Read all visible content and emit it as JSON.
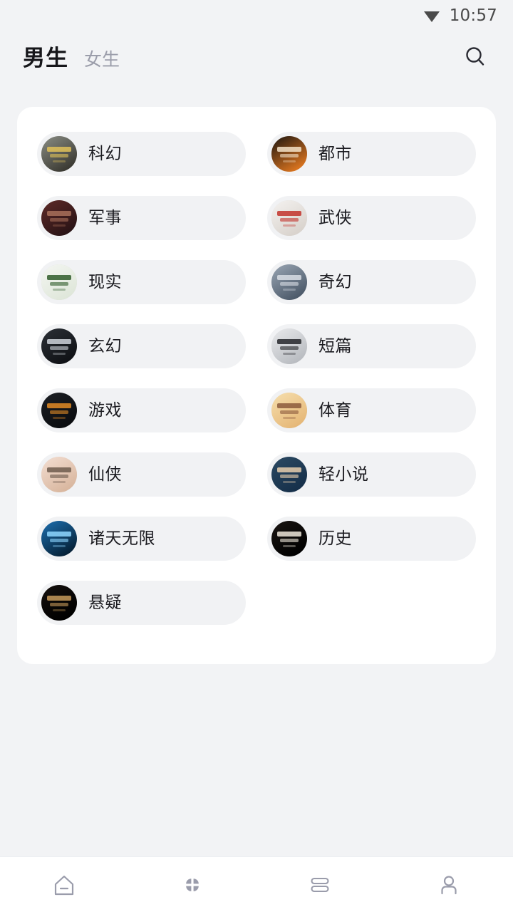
{
  "statusbar": {
    "time": "10:57",
    "wifi_icon": "wifi-icon"
  },
  "header": {
    "tabs": [
      {
        "label": "男生",
        "active": true
      },
      {
        "label": "女生",
        "active": false
      }
    ],
    "search_icon": "search-icon"
  },
  "colors": {
    "page_background": "#f2f3f5",
    "card_background": "#ffffff",
    "pill_background": "#f1f2f4",
    "active_tab_text": "#16161a",
    "inactive_tab_text": "#9b9daa",
    "label_text": "#1b1b20",
    "nav_icon": "#9a9cab",
    "status_text": "#4a4a4a"
  },
  "categories": [
    {
      "label": "科幻",
      "thumb": "sci-fi-cover",
      "c1": "#8a8d84",
      "c2": "#3b3a33",
      "accent": "#e0c159"
    },
    {
      "label": "都市",
      "thumb": "urban-cover",
      "c1": "#1b1510",
      "c2": "#d8731f",
      "accent": "#f5e3c8"
    },
    {
      "label": "军事",
      "thumb": "military-cover",
      "c1": "#5e2a28",
      "c2": "#2a1416",
      "accent": "#a8705a"
    },
    {
      "label": "武侠",
      "thumb": "wuxia-cover",
      "c1": "#f4f2f0",
      "c2": "#d9d3cd",
      "accent": "#c2322b"
    },
    {
      "label": "现实",
      "thumb": "realism-cover",
      "c1": "#f4f6f2",
      "c2": "#dfe7da",
      "accent": "#2f5c2a"
    },
    {
      "label": "奇幻",
      "thumb": "fantasy-cover",
      "c1": "#9aa6b4",
      "c2": "#4c5a6a",
      "accent": "#d8dde4"
    },
    {
      "label": "玄幻",
      "thumb": "xuanhuan-cover",
      "c1": "#2b2f36",
      "c2": "#101216",
      "accent": "#cfd4da"
    },
    {
      "label": "短篇",
      "thumb": "short-story-cover",
      "c1": "#e9eaec",
      "c2": "#b9bcc1",
      "accent": "#24262a"
    },
    {
      "label": "游戏",
      "thumb": "game-cover",
      "c1": "#1c1f24",
      "c2": "#0b0d10",
      "accent": "#e08a25"
    },
    {
      "label": "体育",
      "thumb": "sports-cover",
      "c1": "#f6dfae",
      "c2": "#e6b878",
      "accent": "#8c5a3c"
    },
    {
      "label": "仙侠",
      "thumb": "xianxia-cover",
      "c1": "#f3ded2",
      "c2": "#d9b79f",
      "accent": "#6d5a4c"
    },
    {
      "label": "轻小说",
      "thumb": "light-novel-cover",
      "c1": "#2c4a63",
      "c2": "#16304a",
      "accent": "#e8cfae"
    },
    {
      "label": "诸天无限",
      "thumb": "zhutian-cover",
      "c1": "#1d6fb0",
      "c2": "#062238",
      "accent": "#8fd7ff"
    },
    {
      "label": "历史",
      "thumb": "history-cover",
      "c1": "#1a1512",
      "c2": "#000000",
      "accent": "#efe7da"
    },
    {
      "label": "悬疑",
      "thumb": "suspense-cover",
      "c1": "#15100d",
      "c2": "#000000",
      "accent": "#c79a5a"
    }
  ],
  "tabbar": {
    "items": [
      {
        "name": "home",
        "icon": "home-icon",
        "active": false
      },
      {
        "name": "discover",
        "icon": "clover-icon",
        "active": true
      },
      {
        "name": "bookshelf",
        "icon": "bookshelf-icon",
        "active": false
      },
      {
        "name": "profile",
        "icon": "person-icon",
        "active": false
      }
    ]
  }
}
